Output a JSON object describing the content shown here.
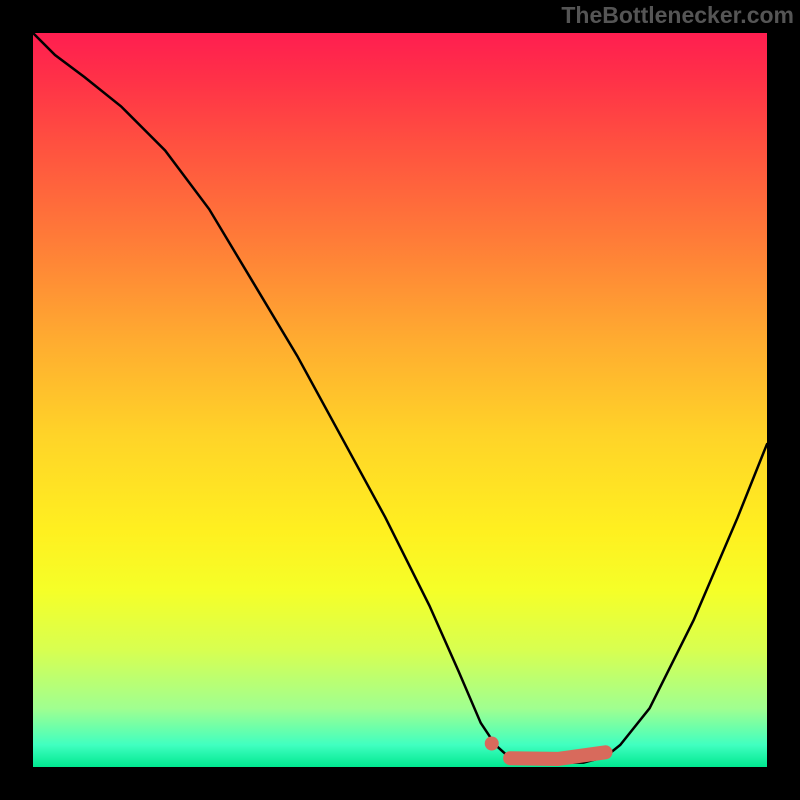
{
  "watermark": "TheBottlenecker.com",
  "colors": {
    "background": "#000000",
    "curve": "#000000",
    "highlight": "#d86a5c"
  },
  "chart_data": {
    "type": "line",
    "title": "",
    "xlabel": "",
    "ylabel": "",
    "xlim": [
      0,
      100
    ],
    "ylim": [
      0,
      100
    ],
    "series": [
      {
        "name": "bottleneck_curve",
        "x": [
          0,
          3,
          7,
          12,
          18,
          24,
          30,
          36,
          42,
          48,
          54,
          58,
          61,
          63,
          65,
          70,
          75,
          78,
          80,
          84,
          90,
          96,
          100
        ],
        "y": [
          100,
          97,
          94,
          90,
          84,
          76,
          66,
          56,
          45,
          34,
          22,
          13,
          6,
          3,
          1.2,
          0.6,
          0.6,
          1.4,
          3,
          8,
          20,
          34,
          44
        ]
      }
    ],
    "highlight": {
      "marker_x": 62.5,
      "marker_y": 3.2,
      "segment": {
        "x0": 65,
        "y0": 1.2,
        "x1": 78,
        "y1": 1.4
      }
    },
    "background_gradient": {
      "type": "vertical",
      "stops": [
        {
          "pos": 0.0,
          "color": "#ff1e50"
        },
        {
          "pos": 0.28,
          "color": "#ff7b38"
        },
        {
          "pos": 0.55,
          "color": "#ffd428"
        },
        {
          "pos": 0.76,
          "color": "#f5ff28"
        },
        {
          "pos": 0.92,
          "color": "#a0ff90"
        },
        {
          "pos": 1.0,
          "color": "#00e890"
        }
      ]
    }
  }
}
